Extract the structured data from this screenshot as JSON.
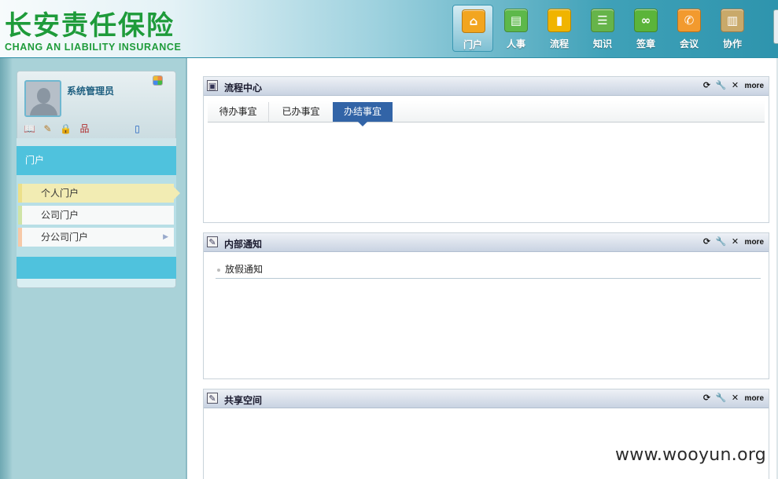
{
  "header": {
    "logo_cn": "长安责任保险",
    "logo_en": "CHANG AN LIABILITY INSURANCE",
    "nav": [
      {
        "label": "门户",
        "icon": "home-icon",
        "color": "#f2a51f",
        "active": true
      },
      {
        "label": "人事",
        "icon": "personnel-icon",
        "color": "#5db84a",
        "active": false
      },
      {
        "label": "流程",
        "icon": "chart-bars-icon",
        "color": "#f0b400",
        "active": false
      },
      {
        "label": "知识",
        "icon": "database-icon",
        "color": "#66b44a",
        "active": false
      },
      {
        "label": "签章",
        "icon": "link-icon",
        "color": "#5bb43a",
        "active": false
      },
      {
        "label": "会议",
        "icon": "phone-icon",
        "color": "#f29a2e",
        "active": false
      },
      {
        "label": "协作",
        "icon": "clipboard-icon",
        "color": "#c9a96a",
        "active": false
      }
    ]
  },
  "sidebar": {
    "user_name": "系统管理员",
    "menu_title": "门户",
    "items": [
      {
        "label": "个人门户",
        "active": true
      },
      {
        "label": "公司门户",
        "active": false
      },
      {
        "label": "分公司门户",
        "active": false,
        "has_arrow": true
      }
    ]
  },
  "panels": {
    "process": {
      "title": "流程中心",
      "more": "more",
      "tabs": [
        "待办事宜",
        "已办事宜",
        "办结事宜"
      ],
      "active_tab": 2
    },
    "notice": {
      "title": "内部通知",
      "more": "more",
      "items": [
        "放假通知"
      ]
    },
    "share": {
      "title": "共享空间",
      "more": "more"
    }
  },
  "watermark": "www.wooyun.org"
}
